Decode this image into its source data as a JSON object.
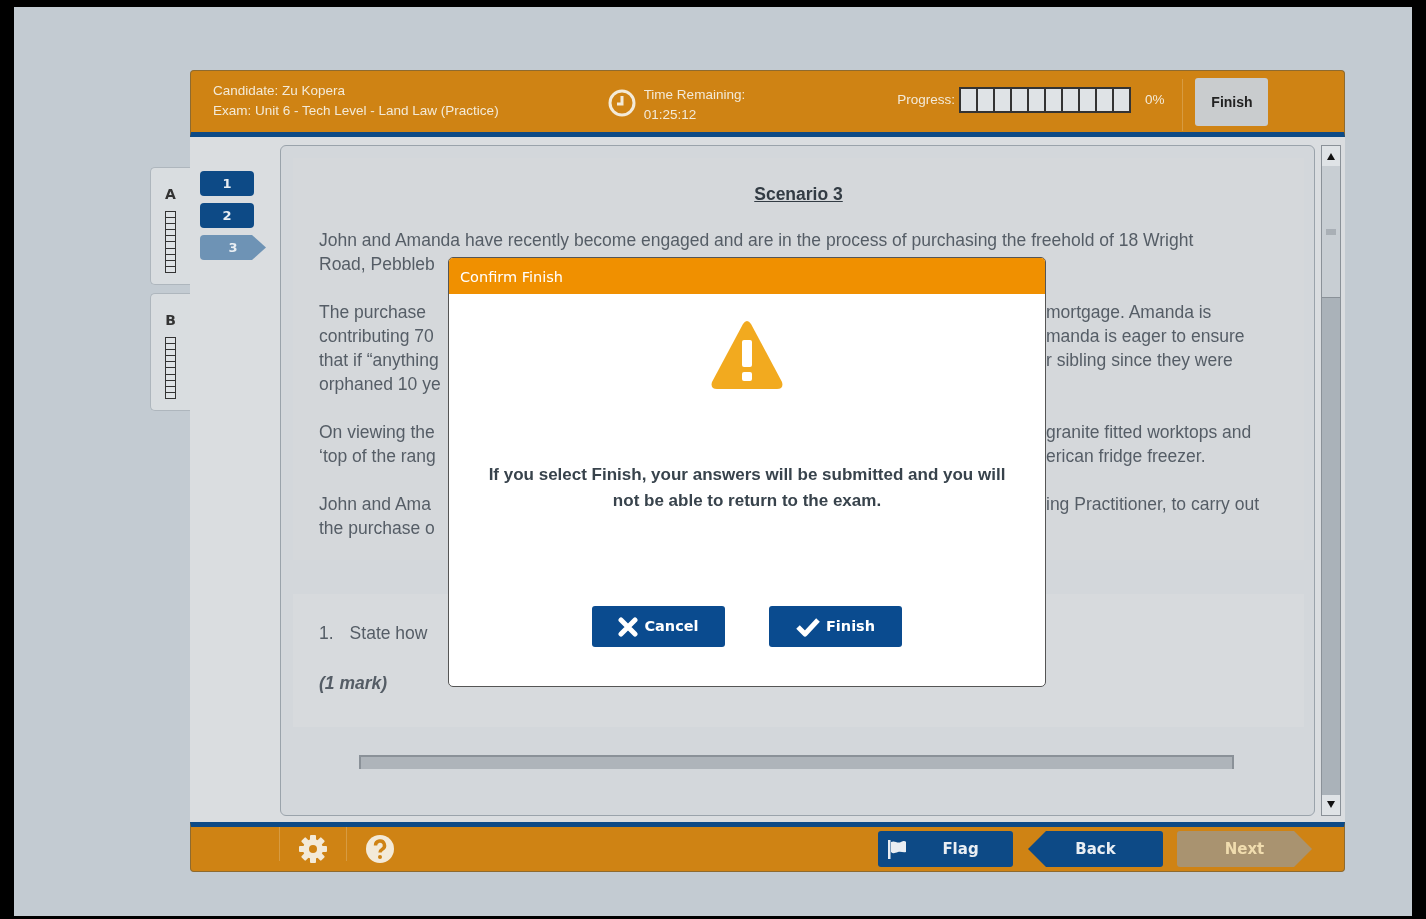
{
  "header": {
    "candidate": "Candidate: Zu Kopera",
    "exam": "Exam: Unit 6 - Tech Level - Land Law (Practice)",
    "time_label": "Time Remaining:",
    "time": "01:25:12",
    "progress_label": "Progress:",
    "progress": {
      "level": 0
    },
    "progress_text": "0%",
    "finish": "Finish"
  },
  "sections": [
    {
      "label": "A",
      "level": 0
    },
    {
      "label": "B",
      "level": 0
    }
  ],
  "questions": [
    {
      "label": "1",
      "selected": false
    },
    {
      "label": "2",
      "selected": false
    },
    {
      "label": "3",
      "selected": true
    }
  ],
  "scenario": {
    "title": "Scenario 3",
    "paragraphs": [
      [
        {
          "full": "John and Amanda have recently become engaged and are in the process of purchasing the freehold of 18 Wright"
        },
        {
          "left": "Road, Pebbleb"
        }
      ],
      [
        {
          "left": "The purchase",
          "right": "mortgage. Amanda is"
        },
        {
          "left": "contributing 70",
          "right": "manda is eager to ensure"
        },
        {
          "left": "that if “anything",
          "right": "r sibling since they were"
        },
        {
          "left": "orphaned 10 ye"
        }
      ],
      [
        {
          "left": "On viewing the",
          "right": "granite fitted worktops and"
        },
        {
          "left": "‘top of the rang",
          "right": "erican fridge freezer."
        }
      ],
      [
        {
          "left": "John and Ama",
          "right": "ing Practitioner, to carry out"
        },
        {
          "left": "the purchase o"
        }
      ]
    ]
  },
  "question": {
    "number": "1.",
    "text": "State how",
    "marks": "(1 mark)"
  },
  "footer": {
    "flag": "Flag",
    "back": "Back",
    "next": {
      "label": "Next",
      "disabled": true
    }
  },
  "dialog": {
    "title": "Confirm Finish",
    "message": "If you select Finish, your answers will be submitted and you will not be able to return to the exam.",
    "cancel": "Cancel",
    "confirm": "Finish"
  }
}
